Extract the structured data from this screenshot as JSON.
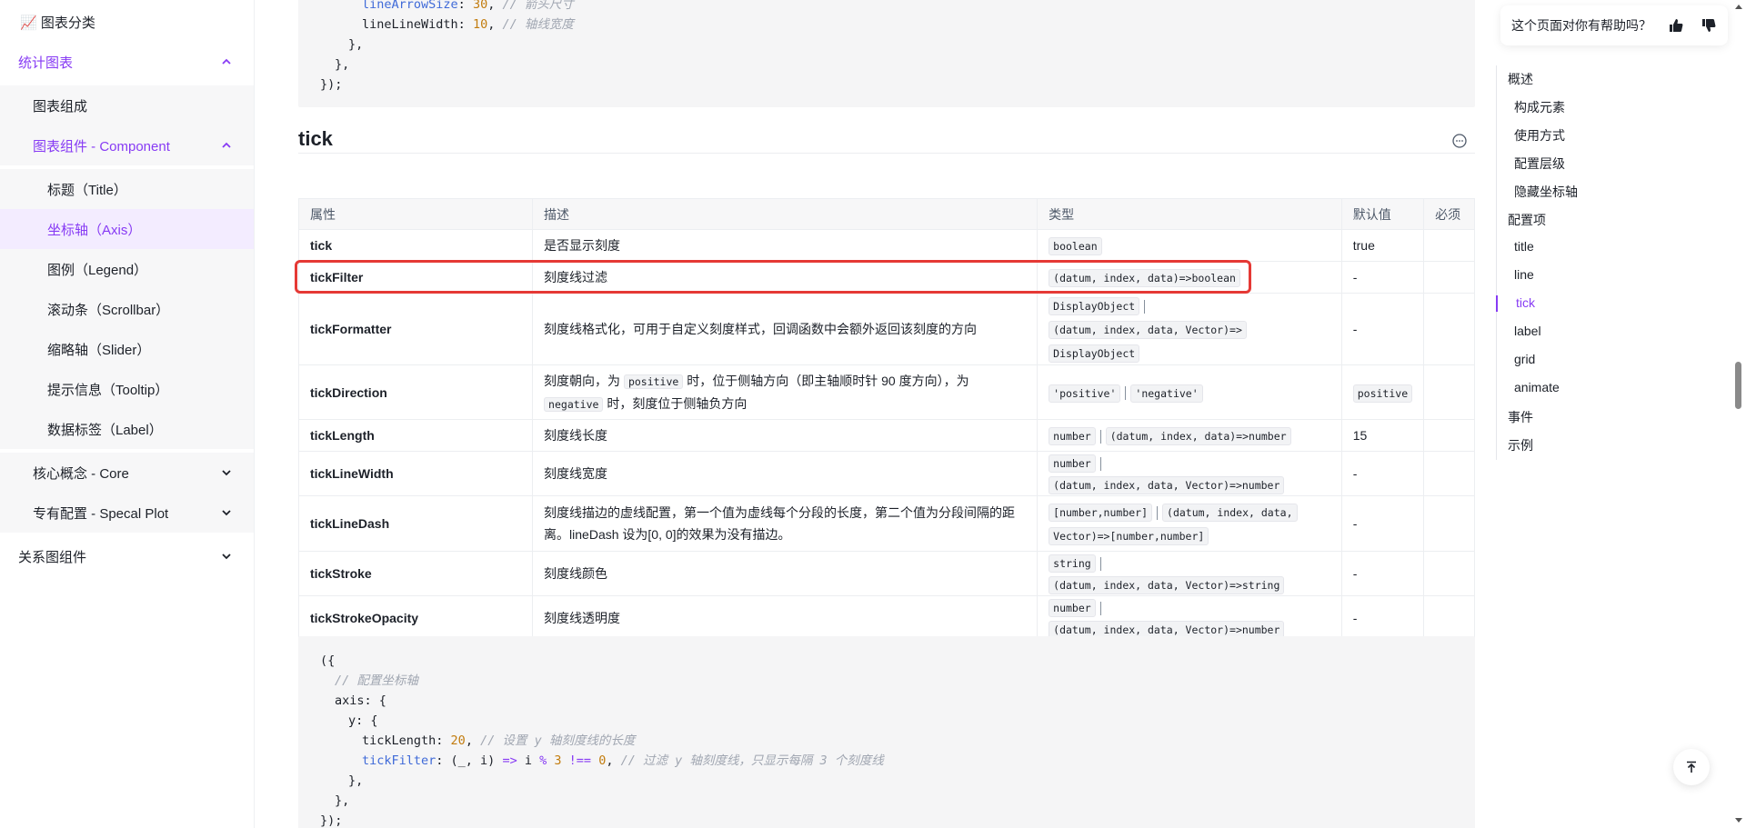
{
  "sidebar": {
    "top_item": "📈 图表分类",
    "items": [
      {
        "label": "统计图表",
        "chevron": "up"
      },
      {
        "label": "图表组成"
      },
      {
        "label": "图表组件 - Component",
        "chevron": "up"
      },
      {
        "label": "标题（Title）"
      },
      {
        "label": "坐标轴（Axis）"
      },
      {
        "label": "图例（Legend）"
      },
      {
        "label": "滚动条（Scrollbar）"
      },
      {
        "label": "缩略轴（Slider）"
      },
      {
        "label": "提示信息（Tooltip）"
      },
      {
        "label": "数据标签（Label）"
      },
      {
        "label": "核心概念 - Core",
        "chevron": "down"
      },
      {
        "label": "专有配置 - Specal Plot",
        "chevron": "down"
      },
      {
        "label": "关系图组件",
        "chevron": "down"
      }
    ]
  },
  "top_code": {
    "line1_key": "lineArrowSize",
    "line1_val": "30",
    "line1_comment": "// 箭头尺寸",
    "line2_key": "lineLineWidth",
    "line2_val": "10",
    "line2_comment": "// 轴线宽度",
    "line3": "},",
    "line4": "},",
    "line5": "});"
  },
  "section": {
    "title": "tick"
  },
  "table": {
    "headers": [
      "属性",
      "描述",
      "类型",
      "默认值",
      "必须"
    ],
    "rows": [
      {
        "name": "tick",
        "desc": "是否显示刻度",
        "types": [
          "boolean"
        ],
        "default": "true"
      },
      {
        "name": "tickFilter",
        "desc": "刻度线过滤",
        "types": [
          "(datum, index, data)=>boolean"
        ],
        "default": "-"
      },
      {
        "name": "tickFormatter",
        "desc": "刻度线格式化，可用于自定义刻度样式，回调函数中会额外返回该刻度的方向",
        "types": [
          "DisplayObject",
          "(datum, index, data, Vector)=>",
          "DisplayObject"
        ],
        "default": "-"
      },
      {
        "name": "tickDirection",
        "desc_parts": [
          "刻度朝向，为 ",
          "positive",
          " 时，位于侧轴方向（即主轴顺时针 90 度方向），为 ",
          "negative",
          " 时，刻度位于侧轴负方向"
        ],
        "types": [
          "'positive'",
          "'negative'"
        ],
        "default": "positive"
      },
      {
        "name": "tickLength",
        "desc": "刻度线长度",
        "types": [
          "number",
          "(datum, index, data)=>number"
        ],
        "default": "15"
      },
      {
        "name": "tickLineWidth",
        "desc": "刻度线宽度",
        "types": [
          "number",
          "(datum, index, data, Vector)=>number"
        ],
        "default": "-"
      },
      {
        "name": "tickLineDash",
        "desc": "刻度线描边的虚线配置，第一个值为虚线每个分段的长度，第二个值为分段间隔的距离。lineDash 设为[0, 0]的效果为没有描边。",
        "types": [
          "[number,number]",
          "(datum, index, data,",
          "Vector)=>[number,number]"
        ],
        "default": "-"
      },
      {
        "name": "tickStroke",
        "desc": "刻度线颜色",
        "types": [
          "string",
          "(datum, index, data, Vector)=>string"
        ],
        "default": "-"
      },
      {
        "name": "tickStrokeOpacity",
        "desc": "刻度线透明度",
        "types": [
          "number",
          "(datum, index, data, Vector)=>number"
        ],
        "default": "-"
      }
    ]
  },
  "bottom_code": {
    "l1": "({",
    "l2": "// 配置坐标轴",
    "l3": "axis: {",
    "l4": "y: {",
    "l5_key": "tickLength",
    "l5_val": "20",
    "l5_comment": "// 设置 y 轴刻度线的长度",
    "l6_key": "tickFilter",
    "l6_fn_a": "(_, i) ",
    "l6_arrow": "=>",
    "l6_fn_b": " i ",
    "l6_mod": "%",
    "l6_three": "3",
    "l6_neq": "!==",
    "l6_zero": "0",
    "l6_comment": "// 过滤 y 轴刻度线，只显示每隔 3 个刻度线",
    "l7": "},",
    "l8": "},",
    "l9": "});"
  },
  "feedback": {
    "question": "这个页面对你有帮助吗？"
  },
  "toc": {
    "items": [
      {
        "label": "概述",
        "level": 1
      },
      {
        "label": "构成元素",
        "level": 2
      },
      {
        "label": "使用方式",
        "level": 2
      },
      {
        "label": "配置层级",
        "level": 2
      },
      {
        "label": "隐藏坐标轴",
        "level": 2
      },
      {
        "label": "配置项",
        "level": 1
      },
      {
        "label": "title",
        "level": 2
      },
      {
        "label": "line",
        "level": 2
      },
      {
        "label": "tick",
        "level": 2,
        "active": true
      },
      {
        "label": "label",
        "level": 2
      },
      {
        "label": "grid",
        "level": 2
      },
      {
        "label": "animate",
        "level": 2
      },
      {
        "label": "事件",
        "level": 1
      },
      {
        "label": "示例",
        "level": 1
      }
    ]
  },
  "colors": {
    "accent": "#873bf4",
    "highlight_border": "#e53935",
    "code_bg": "#f5f5f6"
  }
}
